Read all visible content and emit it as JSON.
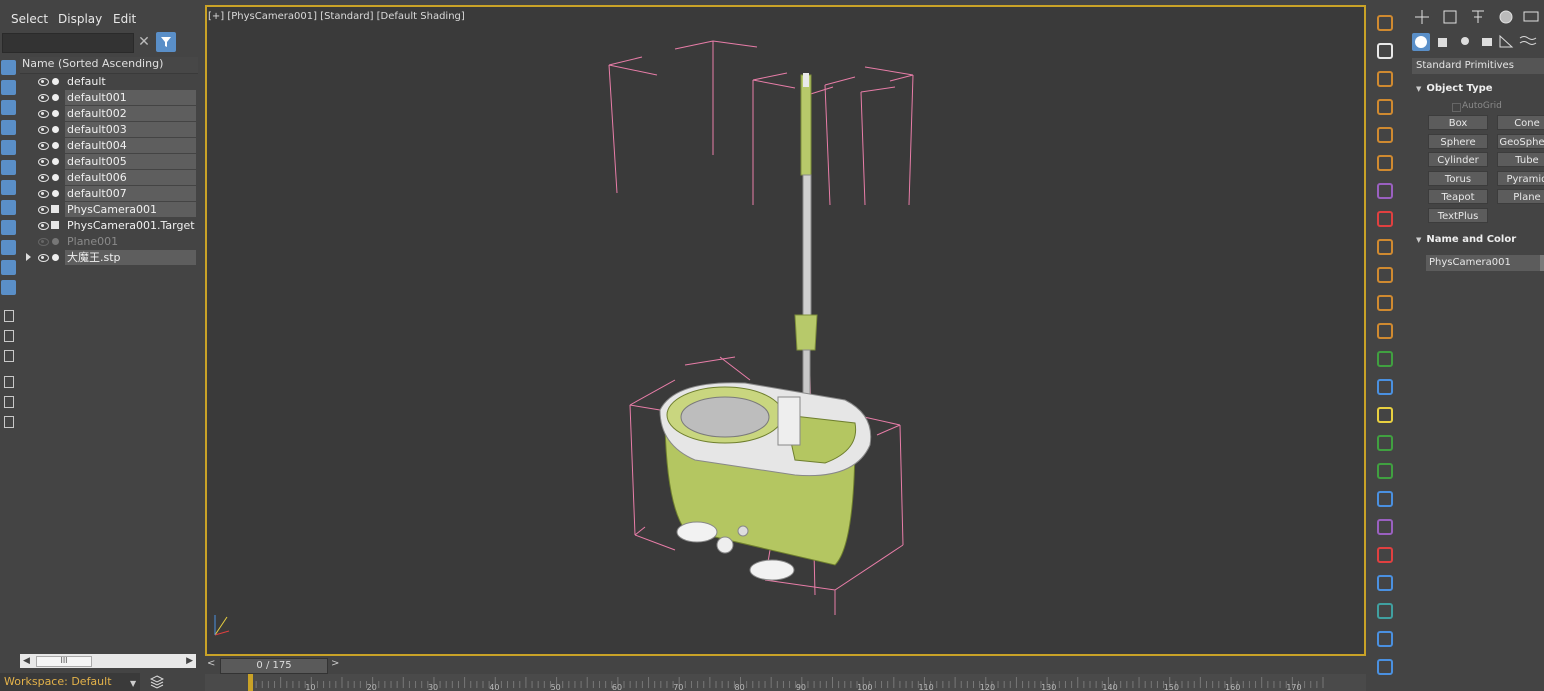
{
  "explorer": {
    "menu": [
      "Select",
      "Display",
      "Edit"
    ],
    "column_header": "Name (Sorted Ascending)",
    "items": [
      {
        "label": "default",
        "kind": "mesh",
        "selected": false,
        "hidden": false
      },
      {
        "label": "default001",
        "kind": "mesh",
        "selected": true,
        "hidden": false
      },
      {
        "label": "default002",
        "kind": "mesh",
        "selected": true,
        "hidden": false
      },
      {
        "label": "default003",
        "kind": "mesh",
        "selected": true,
        "hidden": false
      },
      {
        "label": "default004",
        "kind": "mesh",
        "selected": true,
        "hidden": false
      },
      {
        "label": "default005",
        "kind": "mesh",
        "selected": true,
        "hidden": false
      },
      {
        "label": "default006",
        "kind": "mesh",
        "selected": true,
        "hidden": false
      },
      {
        "label": "default007",
        "kind": "mesh",
        "selected": true,
        "hidden": false
      },
      {
        "label": "PhysCamera001",
        "kind": "camera",
        "selected": true,
        "hidden": false
      },
      {
        "label": "PhysCamera001.Target",
        "kind": "camera",
        "selected": false,
        "hidden": false
      },
      {
        "label": "Plane001",
        "kind": "mesh",
        "selected": false,
        "hidden": true
      },
      {
        "label": "大魔王.stp",
        "kind": "group",
        "selected": true,
        "hidden": false
      }
    ],
    "scrollbar_thumb": "III",
    "workspace": "Workspace: Default"
  },
  "viewport": {
    "label": "[+] [PhysCamera001] [Standard] [Default Shading]",
    "border_color": "#c9a227",
    "model_color": "#b7c96a",
    "bbox_color": "#e87da8"
  },
  "timeline": {
    "frame_display": "0 / 175",
    "prev": "<",
    "next": ">",
    "ticks": [
      "10",
      "20",
      "30",
      "40",
      "50",
      "60",
      "70",
      "80",
      "90",
      "100",
      "110",
      "120",
      "130",
      "140",
      "150",
      "160",
      "170"
    ]
  },
  "command_panel": {
    "dropdown": "Standard Primitives",
    "object_type_title": "Object Type",
    "autogrid": "AutoGrid",
    "buttons": [
      "Box",
      "Cone",
      "Sphere",
      "GeoSphere",
      "Cylinder",
      "Tube",
      "Torus",
      "Pyramid",
      "Teapot",
      "Plane",
      "TextPlus"
    ],
    "name_color_title": "Name and Color",
    "object_name": "PhysCamera001"
  }
}
